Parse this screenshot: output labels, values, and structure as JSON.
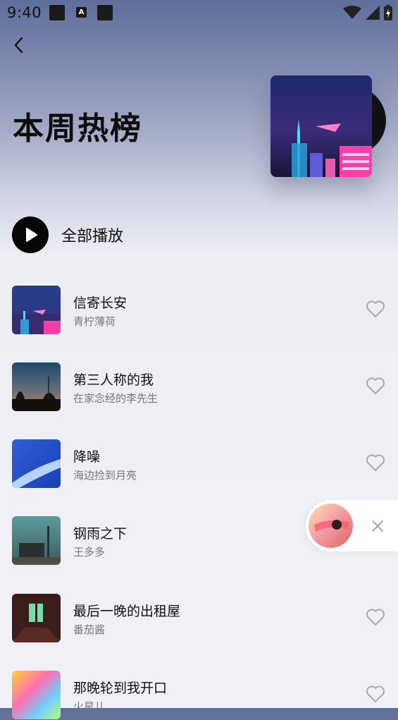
{
  "status_bar": {
    "time": "9:40",
    "a_badge": "A"
  },
  "header": {
    "title": "本周热榜"
  },
  "play_all": {
    "label": "全部播放"
  },
  "songs": [
    {
      "title": "信寄长安",
      "artist": "青柠薄荷"
    },
    {
      "title": "第三人称的我",
      "artist": "在家念经的李先生"
    },
    {
      "title": "降噪",
      "artist": "海边捡到月亮"
    },
    {
      "title": "钢雨之下",
      "artist": "王多多"
    },
    {
      "title": "最后一晚的出租屋",
      "artist": "番茄酱"
    },
    {
      "title": "那晚轮到我开口",
      "artist": "火星儿"
    }
  ],
  "icons": [
    "back-arrow-icon",
    "play-icon",
    "heart-icon",
    "close-icon",
    "wifi-icon",
    "signal-icon",
    "battery-icon"
  ],
  "colors": {
    "accent": "#050505",
    "subtext": "#777777",
    "heart": "#a8a8ad"
  }
}
